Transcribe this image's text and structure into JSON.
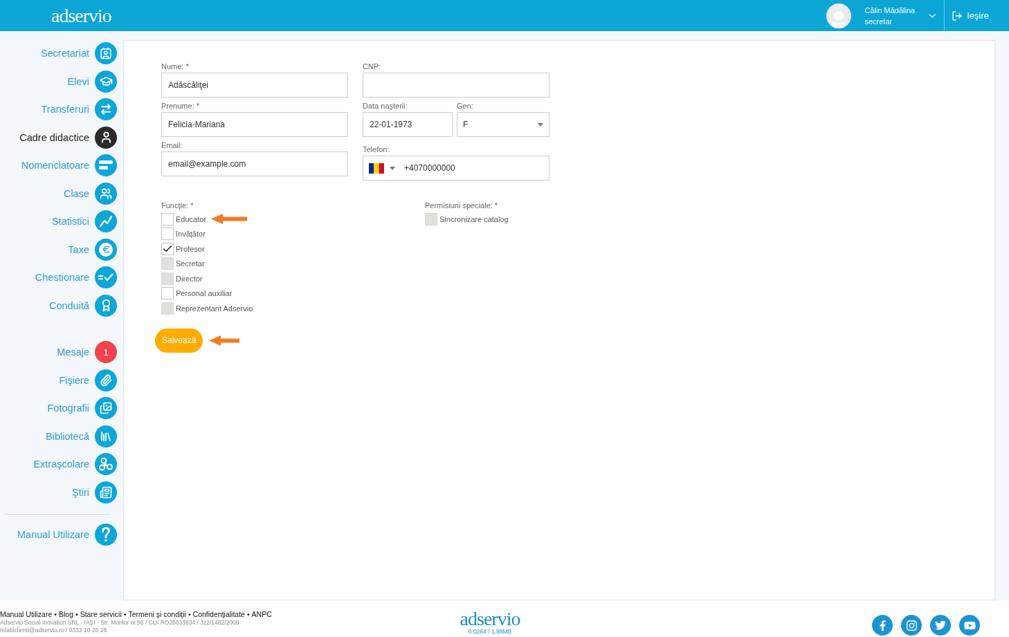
{
  "header": {
    "logo": "adservio",
    "user": {
      "name": "Călin Mădălina",
      "role": "secretar"
    },
    "logout": "Ieşire"
  },
  "sidebar": {
    "sections": [
      {
        "divider_above": false,
        "items": [
          {
            "label": "Secretariat",
            "kind": "icon",
            "selected": false
          },
          {
            "label": "Elevi",
            "kind": "icon",
            "selected": false
          },
          {
            "label": "Transferuri",
            "kind": "icon",
            "selected": false
          },
          {
            "label": "Cadre didactice",
            "kind": "icon",
            "selected": true
          },
          {
            "label": "Nomenclatoare",
            "kind": "icon",
            "selected": false
          },
          {
            "label": "Clase",
            "kind": "icon",
            "selected": false
          },
          {
            "label": "Statistici",
            "kind": "icon",
            "selected": false
          },
          {
            "label": "Taxe",
            "kind": "icon",
            "selected": false
          },
          {
            "label": "Chestionare",
            "kind": "icon",
            "selected": false
          },
          {
            "label": "Conduită",
            "kind": "icon",
            "selected": false
          }
        ]
      },
      {
        "divider_above": false,
        "items": [
          {
            "label": "Mesaje",
            "kind": "count",
            "count": "1",
            "selected": false
          },
          {
            "label": "Fişiere",
            "kind": "icon",
            "selected": false
          },
          {
            "label": "Fotografii",
            "kind": "icon",
            "selected": false
          },
          {
            "label": "Bibliotecă",
            "kind": "icon",
            "selected": false
          },
          {
            "label": "Extraşcolare",
            "kind": "icon",
            "selected": false
          },
          {
            "label": "Ştiri",
            "kind": "icon",
            "selected": false
          }
        ]
      },
      {
        "divider_above": true,
        "items": [
          {
            "label": "Manual Utilizare",
            "kind": "icon",
            "selected": false
          }
        ]
      }
    ]
  },
  "form": {
    "name": {
      "label": "Nume: *",
      "value": "Adăscăliţei"
    },
    "first_name": {
      "label": "Prenume: *",
      "value": "Felicia-Mariana"
    },
    "email": {
      "label": "Email:",
      "value": "email@example.com"
    },
    "cnp": {
      "label": "CNP:"
    },
    "birth_date": {
      "label": "Data naşterii:",
      "value": "22-01-1973"
    },
    "gender": {
      "label": "Gen:",
      "value": "F"
    },
    "phone": {
      "label": "Telefon:",
      "value": "+4070000000"
    },
    "functions": {
      "label": "Funcţie: *",
      "options": [
        {
          "label": "Educator",
          "checked": false,
          "disabled": false,
          "pointer_arrow": true
        },
        {
          "label": "învăţător",
          "checked": false,
          "disabled": false,
          "pointer_arrow": false
        },
        {
          "label": "Profesor",
          "checked": true,
          "disabled": false,
          "pointer_arrow": false
        },
        {
          "label": "Secretar",
          "checked": false,
          "disabled": true,
          "pointer_arrow": false
        },
        {
          "label": "Director",
          "checked": false,
          "disabled": true,
          "pointer_arrow": false
        },
        {
          "label": "Personal auxiliar",
          "checked": false,
          "disabled": false,
          "pointer_arrow": false
        },
        {
          "label": "Reprezentant Adservio",
          "checked": false,
          "disabled": true,
          "pointer_arrow": false
        }
      ]
    },
    "permissions": {
      "label": "Permisiuni speciale: *",
      "options": [
        {
          "label": "Sincronizare catalog",
          "checked": false,
          "disabled": true,
          "pointer_arrow": false
        }
      ]
    },
    "save_button": {
      "label": "Salvează",
      "pointer_arrow": true
    }
  },
  "footer": {
    "links": [
      "Manual Utilizare",
      "Blog",
      "Stare servicii",
      "Termeni şi condiţii",
      "Confidenţialitate",
      "ANPC"
    ],
    "separator": "•",
    "company": "Adservio Social Inovation SRL - IAŞI - Str. Morilor nr.56 / CUI RO26033834 / J22/1482/2009",
    "contact": "relatiiclienti@adservio.ro / 0332 10 28 28",
    "logo": "adservio",
    "stats": "0.0264 / 1.98MB"
  }
}
